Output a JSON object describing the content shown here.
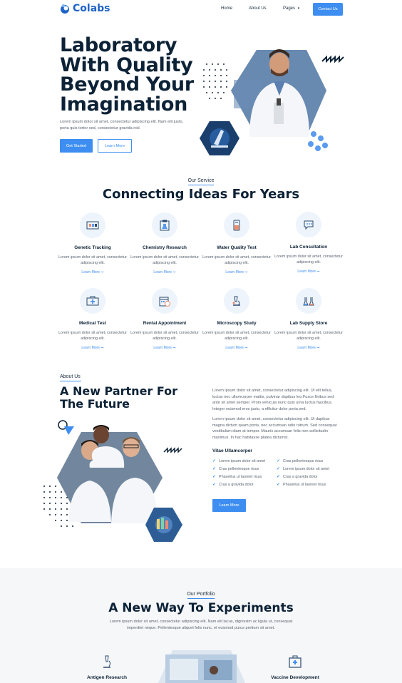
{
  "nav": {
    "brand": "Colabs",
    "links": [
      "Home",
      "About Us",
      "Pages"
    ],
    "cta": "Contact Us"
  },
  "hero": {
    "title": "Laboratory With Quality Beyond Your Imagination",
    "description": "Lorem ipsum dolor sit amet, consectetur adipiscing elit. Nam elit justo, porta quis tortor sed, consectetur gravida nisl.",
    "primary_button": "Get Started",
    "secondary_button": "Learn More"
  },
  "services": {
    "eyebrow": "Our Service",
    "title": "Connecting Ideas For Years",
    "items": [
      {
        "title": "Genetic Tracking",
        "desc": "Lorem ipsum dolor sit amet, consectetur adipiscing elit.",
        "link": "Learn More ➞",
        "icon": "microscope-slide-icon"
      },
      {
        "title": "Chemistry Research",
        "desc": "Lorem ipsum dolor sit amet, consectetur adipiscing elit.",
        "link": "Learn More ➞",
        "icon": "clipboard-flask-icon"
      },
      {
        "title": "Water Quality Test",
        "desc": "Lorem ipsum dolor sit amet, consectetur adipiscing elit.",
        "link": "Learn More ➞",
        "icon": "test-tube-icon"
      },
      {
        "title": "Lab Consultation",
        "desc": "Lorem ipsum dolor sit amet, consectetur adipiscing elit.",
        "link": "Learn More ➞",
        "icon": "chat-bubble-icon"
      },
      {
        "title": "Medical Test",
        "desc": "Lorem ipsum dolor sit amet, consectetur adipiscing elit.",
        "link": "Learn More ➞",
        "icon": "medical-kit-icon"
      },
      {
        "title": "Rental Appointment",
        "desc": "Lorem ipsum dolor sit amet, consectetur adipiscing elit.",
        "link": "Learn More ➞",
        "icon": "calendar-icon"
      },
      {
        "title": "Microscopy Study",
        "desc": "Lorem ipsum dolor sit amet, consectetur adipiscing elit.",
        "link": "Learn More ➞",
        "icon": "microscope-icon"
      },
      {
        "title": "Lab Supply Store",
        "desc": "Lorem ipsum dolor sit amet, consectetur adipiscing elit.",
        "link": "Learn More ➞",
        "icon": "flask-icon"
      }
    ]
  },
  "about": {
    "eyebrow": "About Us",
    "title": "A New Partner For The Future",
    "para1": "Lorem ipsum dolor sit amet, consectetur adipiscing elit. Ut elit tellus, luctus nec ullamcorper mattis, pulvinar dapibus leo.Fusce finibus sed ante sit amet semper. Proin vehicula nunc quis urna luctus faucibus. Integer euismod eros justo, a efficitur dolor porta sed.",
    "para2": "Lorem ipsum dolor sit amet, consectetur adipiscing elit. Ut dapibus magna dictum quam porta, nec accumsan odio rutrum. Sed consequat vestibulum diam at tempor. Mauris accumsan felis non sollicitudin maximus. In hac habitasse platea dictumst.",
    "list_title": "Vitae Ullamcorper",
    "list_left": [
      "Lorem ipsum dolor sit amet",
      "Cras pellentesque risus",
      "Phasellus ut laoreet risus",
      "Cras a gravida dolor"
    ],
    "list_right": [
      "Cras pellentesque risus",
      "Lorem ipsum dolor sit amet",
      "Cras a gravida dolor",
      "Phasellus ut laoreet risus"
    ],
    "button": "Learn More"
  },
  "portfolio": {
    "eyebrow": "Our Portfolio",
    "title": "A New Way To Experiments",
    "description": "Lorem ipsum dolor sit amet, consectetur adipiscing elit. Nam elit lacus, dignissim ac ligula ut, consequat imperdiet neque. Pellentesque aliquet felis nunc, et euismod purus pretium sit amet.",
    "items": [
      "Antigen Research",
      "Vaccine Development"
    ]
  },
  "colors": {
    "accent": "#3d8ef0",
    "heading": "#0d2236",
    "text": "#5a6470",
    "brand": "#1f63c7"
  }
}
